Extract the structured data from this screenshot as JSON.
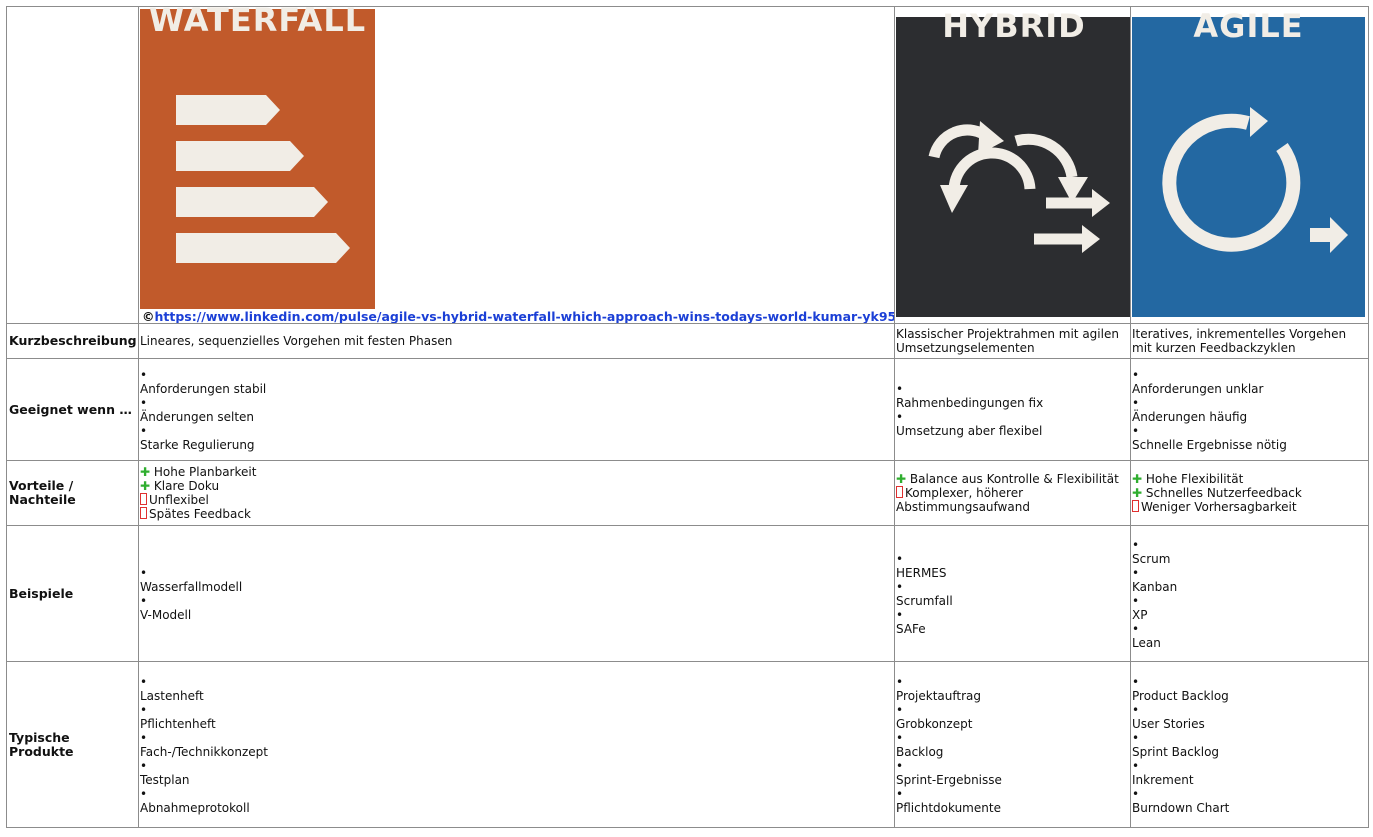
{
  "images": {
    "waterfall": {
      "title": "WATERFALL",
      "bg": "#c15a2b"
    },
    "hybrid": {
      "title": "HYBRID",
      "bg": "#2c2d30"
    },
    "agile": {
      "title": "AGILE",
      "bg": "#2368a2"
    }
  },
  "credit": {
    "prefix": "©",
    "link": "https://www.linkedin.com/pulse/agile-vs-hybrid-waterfall-which-approach-wins-todays-world-kumar-yk95c"
  },
  "rows": {
    "kurz": {
      "label": "Kurzbeschreibung",
      "waterfall": "Lineares, sequenzielles Vorgehen mit festen Phasen",
      "hybrid": "Klassischer Projektrahmen mit agilen Umsetzungselementen",
      "agile": "Iteratives, inkrementelles Vorgehen mit kurzen Feedbackzyklen"
    },
    "geeignet": {
      "label": "Geeignet wenn …",
      "bullet": "•",
      "waterfall": [
        "Anforderungen stabil",
        "Änderungen selten",
        "Starke Regulierung"
      ],
      "hybrid": [
        "Rahmenbedingungen fix",
        "Umsetzung aber flexibel"
      ],
      "agile": [
        "Anforderungen unklar",
        "Änderungen häufig",
        "Schnelle Ergebnisse nötig"
      ]
    },
    "vorteile": {
      "label": "Vorteile / Nachteile",
      "plus": "✚",
      "waterfall": {
        "pros": [
          "Hohe Planbarkeit",
          "Klare Doku"
        ],
        "cons": [
          "Unflexibel",
          "Spätes Feedback"
        ]
      },
      "hybrid": {
        "pros": [
          "Balance aus Kontrolle & Flexibilität"
        ],
        "cons": [
          "Komplexer, höherer Abstimmungsaufwand"
        ]
      },
      "agile": {
        "pros": [
          "Hohe Flexibilität",
          "Schnelles Nutzerfeedback"
        ],
        "cons": [
          "Weniger Vorhersagbarkeit"
        ]
      }
    },
    "beispiele": {
      "label": "Beispiele",
      "waterfall": [
        "Wasserfallmodell",
        "V-Modell"
      ],
      "hybrid": [
        "HERMES",
        "Scrumfall",
        "SAFe"
      ],
      "agile": [
        "Scrum",
        "Kanban",
        "XP",
        "Lean"
      ]
    },
    "produkte": {
      "label": "Typische Produkte",
      "waterfall": [
        "Lastenheft",
        "Pflichtenheft",
        "Fach-/Technikkonzept",
        "Testplan",
        "Abnahmeprotokoll"
      ],
      "hybrid": [
        "Projektauftrag",
        "Grobkonzept",
        "Backlog",
        "Sprint-Ergebnisse",
        "Pflichtdokumente"
      ],
      "agile": [
        "Product Backlog",
        "User Stories",
        "Sprint Backlog",
        "Inkrement",
        "Burndown Chart"
      ]
    }
  }
}
